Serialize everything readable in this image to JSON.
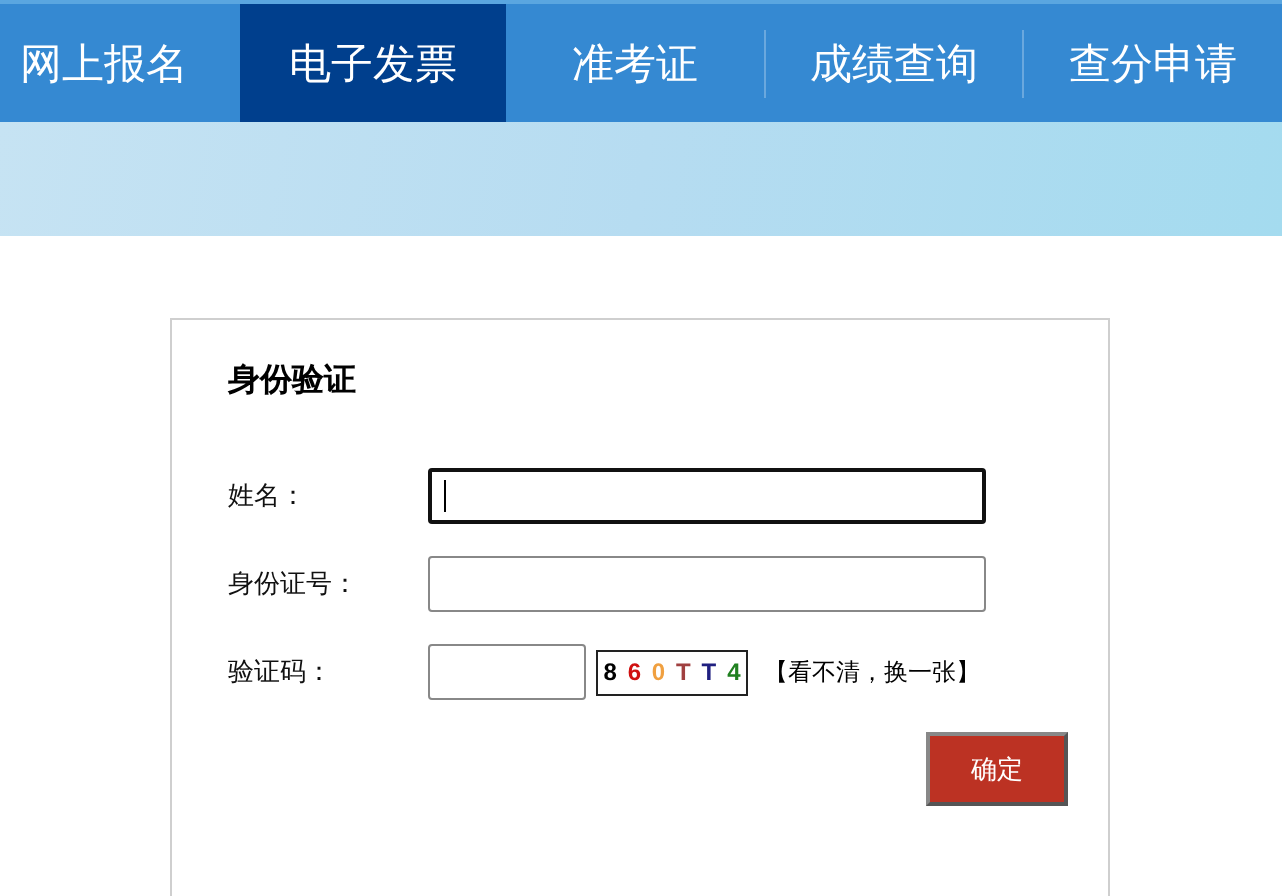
{
  "nav": [
    {
      "label": "网上报名",
      "selected": false
    },
    {
      "label": "电子发票",
      "selected": true
    },
    {
      "label": "准考证",
      "selected": false
    },
    {
      "label": "成绩查询",
      "selected": false
    },
    {
      "label": "查分申请",
      "selected": false
    }
  ],
  "form": {
    "title": "身份验证",
    "fields": [
      {
        "label": "姓名：",
        "kind": "text",
        "focused": true
      },
      {
        "label": "身份证号：",
        "kind": "text",
        "focused": false
      },
      {
        "label": "验证码：",
        "kind": "captcha",
        "focused": false
      }
    ],
    "captcha": [
      {
        "char": "8",
        "color": "#000000"
      },
      {
        "char": "6",
        "color": "#d01010"
      },
      {
        "char": "0",
        "color": "#f0a040"
      },
      {
        "char": "T",
        "color": "#a04040"
      },
      {
        "char": "T",
        "color": "#202080"
      },
      {
        "char": "4",
        "color": "#208020"
      }
    ],
    "refresh_link": "【看不清，换一张】",
    "submit": "确定"
  }
}
